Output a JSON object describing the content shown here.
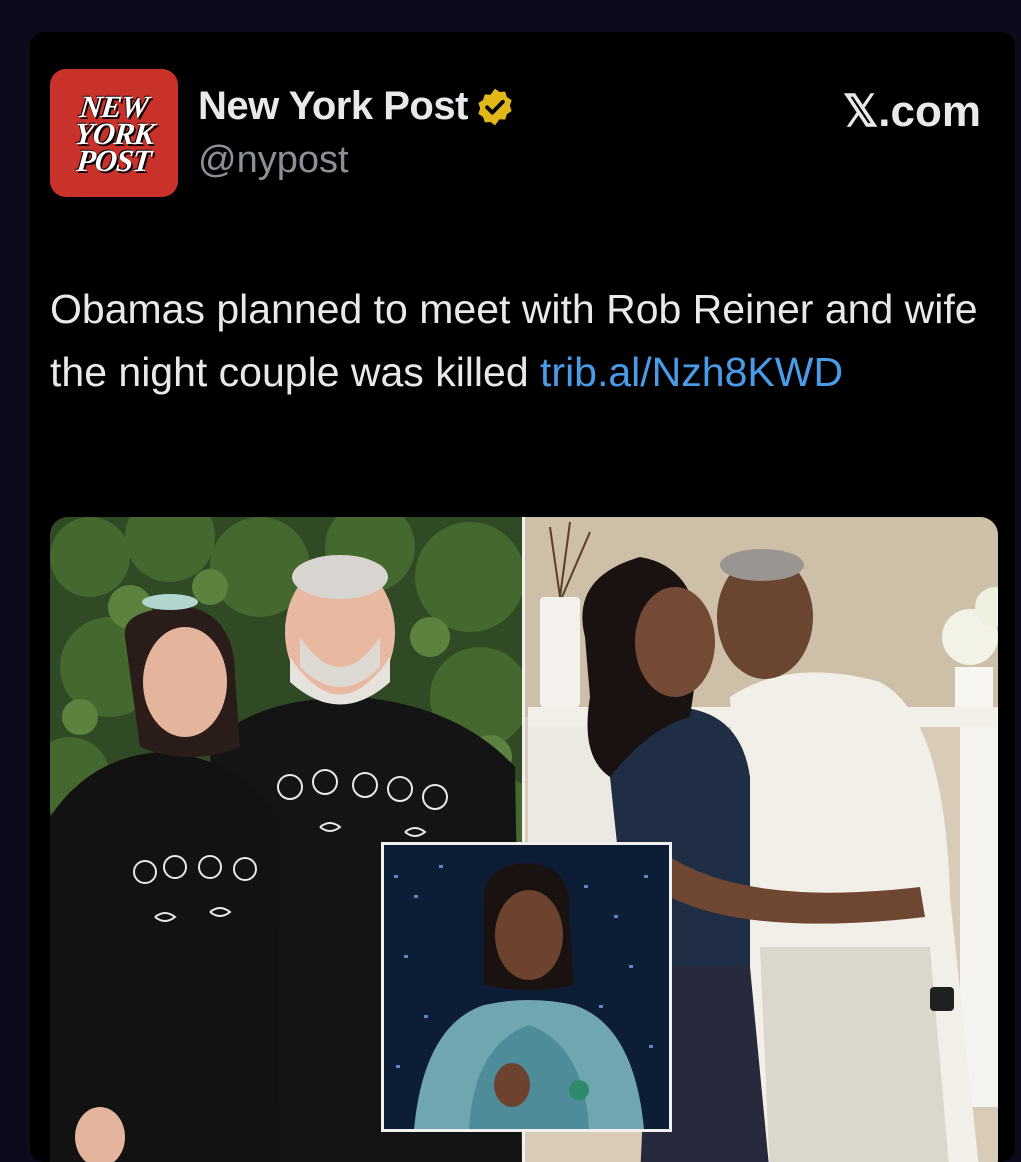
{
  "account": {
    "logo_lines": [
      "NEW",
      "YORK",
      "POST"
    ],
    "display_name": "New York Post",
    "handle": "@nypost",
    "verified_color": "#e2b719"
  },
  "brand": "𝕏.com",
  "tweet": {
    "text": "Obamas planned to meet with Rob Reiner and wife the night couple was killed ",
    "link_text": "trib.al/Nzh8KWD",
    "link_color": "#4a9be8"
  },
  "media": {
    "left_photo": "couple-in-black-sweatshirts-photo",
    "right_photo": "couple-embracing-photo",
    "inset_photo": "woman-on-talk-show-photo"
  }
}
